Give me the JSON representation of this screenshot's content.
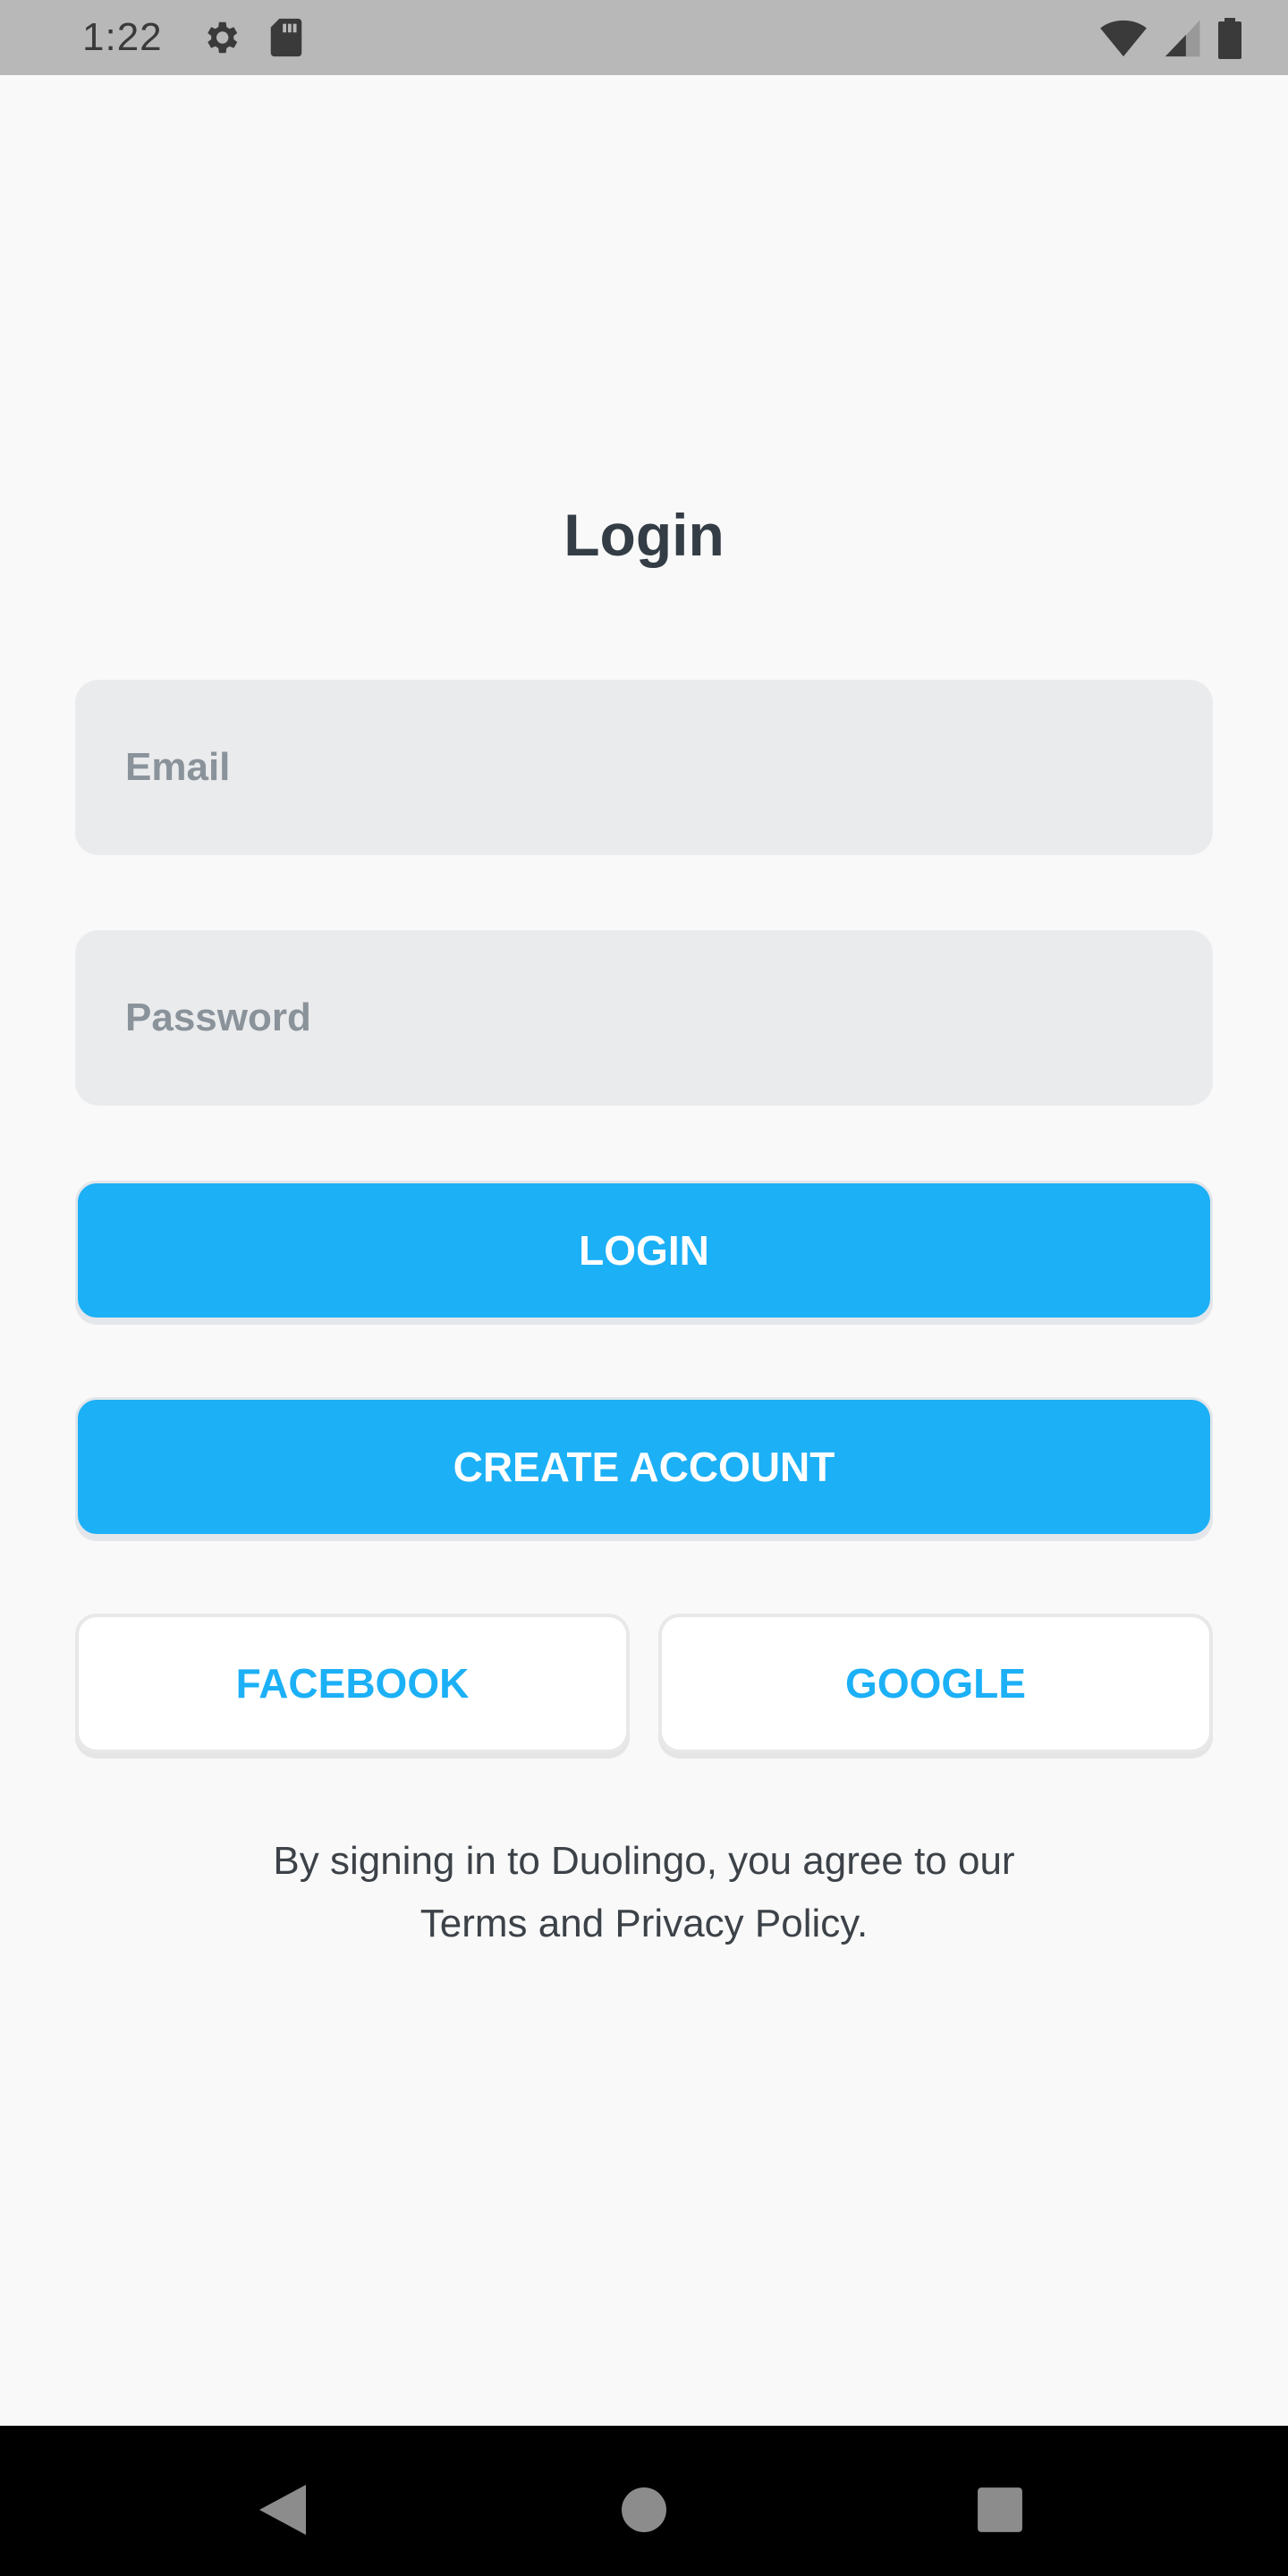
{
  "status_bar": {
    "time": "1:22",
    "icons": [
      "settings-gear-icon",
      "sd-card-icon",
      "wifi-icon",
      "cellular-signal-icon",
      "battery-icon"
    ]
  },
  "login_screen": {
    "title": "Login",
    "email_placeholder": "Email",
    "password_placeholder": "Password",
    "login_button": "LOGIN",
    "create_account_button": "CREATE ACCOUNT",
    "facebook_button": "FACEBOOK",
    "google_button": "GOOGLE",
    "legal_line_1": "By signing in to Duolingo, you agree to our",
    "legal_line_2": "Terms and Privacy Policy."
  },
  "nav_bar": {
    "icons": [
      "back-icon",
      "home-icon",
      "recents-icon"
    ]
  },
  "colors": {
    "accent": "#1cb0f6",
    "title_text": "#343d45",
    "field_bg": "#eaebed",
    "status_bar_bg": "#b8b8b8"
  }
}
